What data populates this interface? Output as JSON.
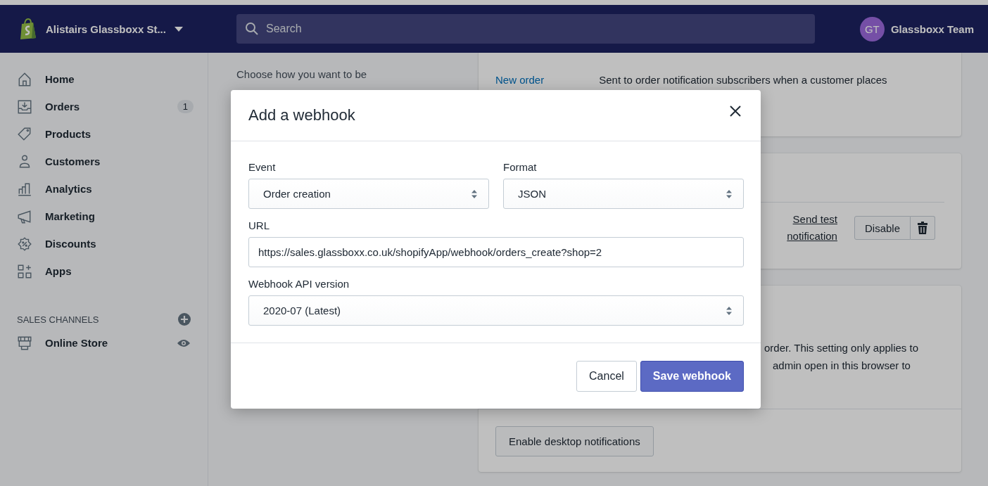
{
  "top_bar": {
    "store_name": "Alistairs Glassboxx St...",
    "search_placeholder": "Search",
    "user": {
      "initials": "GT",
      "name": "Glassboxx Team"
    }
  },
  "sidebar": {
    "items": [
      {
        "label": "Home"
      },
      {
        "label": "Orders",
        "badge": "1"
      },
      {
        "label": "Products"
      },
      {
        "label": "Customers"
      },
      {
        "label": "Analytics"
      },
      {
        "label": "Marketing"
      },
      {
        "label": "Discounts"
      },
      {
        "label": "Apps"
      }
    ],
    "sales_channels": {
      "heading": "SALES CHANNELS",
      "items": [
        {
          "label": "Online Store"
        }
      ]
    }
  },
  "main": {
    "intro": "Choose how you want to be",
    "order_card": {
      "link": "New order",
      "description": "Sent to order notification subscribers when a customer places"
    },
    "webhook_card": {
      "test_link": "Send test notification",
      "disable_button": "Disable"
    },
    "desktop_card": {
      "lines": [
        "order. This setting only applies to",
        "admin open in this browser to"
      ],
      "button": "Enable desktop notifications"
    }
  },
  "modal": {
    "title": "Add a webhook",
    "fields": [
      {
        "kind": "select",
        "label": "Event",
        "value": "Order creation"
      },
      {
        "kind": "select",
        "label": "Format",
        "value": "JSON"
      },
      {
        "kind": "text",
        "label": "URL",
        "value": "https://sales.glassboxx.co.uk/shopifyApp/webhook/orders_create?shop=2"
      },
      {
        "kind": "select",
        "label": "Webhook API version",
        "value": "2020-07 (Latest)"
      }
    ],
    "buttons": [
      {
        "kind": "secondary",
        "label": "Cancel"
      },
      {
        "kind": "primary",
        "label": "Save webhook"
      }
    ]
  }
}
